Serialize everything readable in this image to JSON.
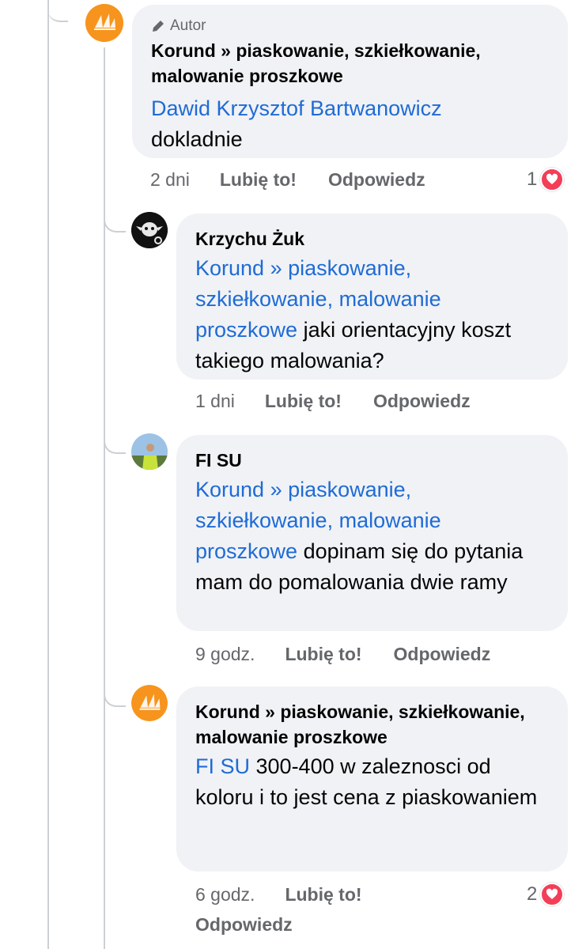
{
  "comments": [
    {
      "badge": "Autor",
      "name": "Korund » piaskowanie,  szkiełkowanie, malowanie proszkowe",
      "mention": "Dawid Krzysztof Bartwanowicz",
      "text": "dokladnie",
      "time": "2 dni",
      "like": "Lubię to!",
      "reply": "Odpowiedz",
      "reactions": "1"
    },
    {
      "name": "Krzychu Żuk",
      "mention": "Korund » piaskowanie, szkiełkowanie,  malowanie proszkowe",
      "text": " jaki orientacyjny koszt takiego malowania?",
      "time": "1 dni",
      "like": "Lubię to!",
      "reply": "Odpowiedz"
    },
    {
      "name": "FI SU",
      "mention": "Korund » piaskowanie, szkiełkowanie,  malowanie proszkowe",
      "text": " dopinam się do pytania mam do pomalowania dwie ramy",
      "time": "9 godz.",
      "like": "Lubię to!",
      "reply": "Odpowiedz"
    },
    {
      "name": "Korund » piaskowanie, szkiełkowanie,  malowanie proszkowe",
      "mention": "FI SU",
      "text": " 300-400 w zaleznosci od koloru i to jest cena z piaskowaniem",
      "time": "6 godz.",
      "like": "Lubię to!",
      "reply": "Odpowiedz",
      "reactions": "2"
    }
  ],
  "colors": {
    "link": "#1f6bd6",
    "bubble": "#f0f2f5",
    "brand": "#f7941d",
    "heart": "#f33e58"
  },
  "icons": {
    "badge": "pencil-icon",
    "reaction": "heart-icon"
  }
}
